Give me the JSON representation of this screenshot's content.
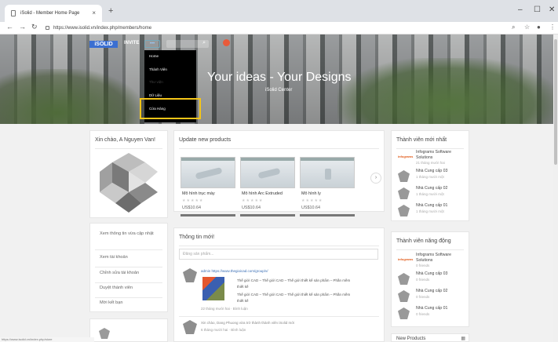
{
  "browser": {
    "tab_title": "iSolid - Member Home Page",
    "tab_close": "×",
    "new_tab": "+",
    "url": "https://www.isolid.vn/index.php/members/home",
    "status_url": "https://www.isolid.vn/index.php/store"
  },
  "nav": {
    "logo": "iSOLID",
    "invite": "INVITE",
    "dropdown": [
      "Home",
      "Thành Viên",
      "Thư viện",
      "Dữ Liệu",
      "Cửa Hàng"
    ]
  },
  "hero": {
    "title": "Your ideas - Your Designs",
    "subtitle": "iSolid Center"
  },
  "profile": {
    "greeting": "Xin chào, A Nguyen Van!"
  },
  "profile_links": [
    "Xem thông tin vừa cập nhật",
    "Xem tài khoản",
    "Chỉnh sửa tài khoản",
    "Duyệt thành viên",
    "Mời kết bạn"
  ],
  "products": {
    "title": "Update new products",
    "items": [
      {
        "name": "Mô hình trục máy",
        "price": "US$10.64"
      },
      {
        "name": "Mô hình Arc Extruded",
        "price": "US$10.64"
      },
      {
        "name": "Mô hình ly",
        "price": "US$10.64"
      }
    ]
  },
  "news": {
    "title": "Thông tin mới!",
    "search_placeholder": "Đăng sản phẩm...",
    "post1_author": "admin https://www.thegioicad.com/group/v/",
    "post1_line1": "Thế giới CAD – Thế giới CAD – Thế giới thiết kế sản phẩm – Phần mềm",
    "post1_line1b": "thiết kế",
    "post1_line2": "Thế giới CAD – Thế giới CAD – Thế giới thiết kế sản phẩm – Phần mềm",
    "post1_line2b": "thiết kế",
    "post1_meta": "22 tháng mười hai · Bình luận",
    "post2_text": "Xin chào, Dang Phuong vừa trở thành thành viên iSolid mới",
    "post2_meta": "6 tháng mười hai · Bình luận"
  },
  "new_members": {
    "title": "Thành viên mới nhất",
    "items": [
      {
        "name": "Infograms Software",
        "name2": "Solutions",
        "sub": "21 tháng mười hai"
      },
      {
        "name": "Nhà Cung cấp 03",
        "sub": "1 tháng mười một"
      },
      {
        "name": "Nhà Cung cấp 02",
        "sub": "1 tháng mười một"
      },
      {
        "name": "Nhà Cung cấp 01",
        "sub": "1 tháng mười một"
      }
    ]
  },
  "active_members": {
    "title": "Thành viên năng động",
    "items": [
      {
        "name": "Infograms Software",
        "name2": "Solutions",
        "sub": "0 friends"
      },
      {
        "name": "Nhà Cung cấp 03",
        "sub": "0 friends"
      },
      {
        "name": "Nhà Cung cấp 02",
        "sub": "0 friends"
      },
      {
        "name": "Nhà Cung cấp 01",
        "sub": "0 friends"
      }
    ]
  },
  "new_products_footer": "New Products"
}
